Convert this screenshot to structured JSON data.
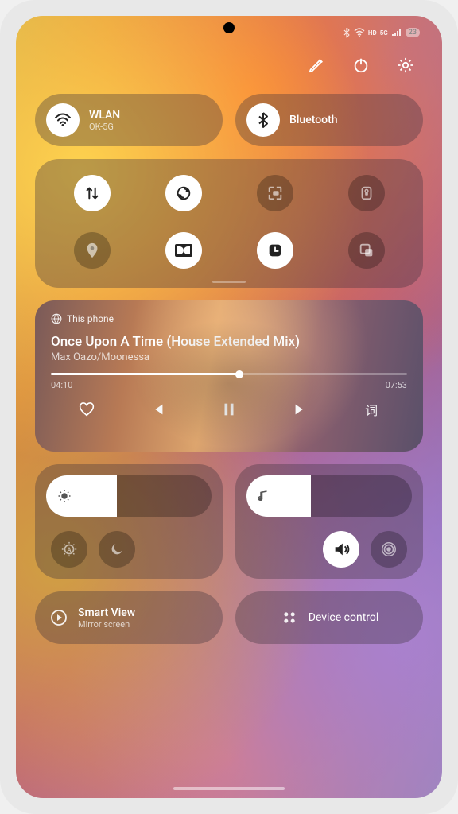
{
  "status_bar": {
    "battery_percent": "23"
  },
  "header": {
    "edit": "",
    "power": "",
    "settings": ""
  },
  "quick_pills": {
    "wifi": {
      "title": "WLAN",
      "subtitle": "OK-5G"
    },
    "bluetooth": {
      "title": "Bluetooth"
    }
  },
  "toggles": [
    {
      "name": "data-transfer",
      "on": true
    },
    {
      "name": "sync",
      "on": true
    },
    {
      "name": "screen-record",
      "on": false
    },
    {
      "name": "rotation-lock",
      "on": false
    },
    {
      "name": "location",
      "on": false
    },
    {
      "name": "dolby",
      "on": true
    },
    {
      "name": "clock-dnd",
      "on": true
    },
    {
      "name": "multi-window",
      "on": false
    }
  ],
  "media": {
    "source_label": "This phone",
    "title": "Once Upon A Time (House Extended Mix)",
    "artist": "Max Oazo/Moonessa",
    "elapsed": "04:10",
    "duration": "07:53",
    "progress_pct": 53,
    "lyrics_label": "词"
  },
  "sliders": {
    "brightness": {
      "value_pct": 36
    },
    "volume": {
      "value_pct": 32
    }
  },
  "bottom": {
    "smart_view": {
      "title": "Smart View",
      "subtitle": "Mirror screen"
    },
    "device_control": {
      "title": "Device control"
    }
  }
}
